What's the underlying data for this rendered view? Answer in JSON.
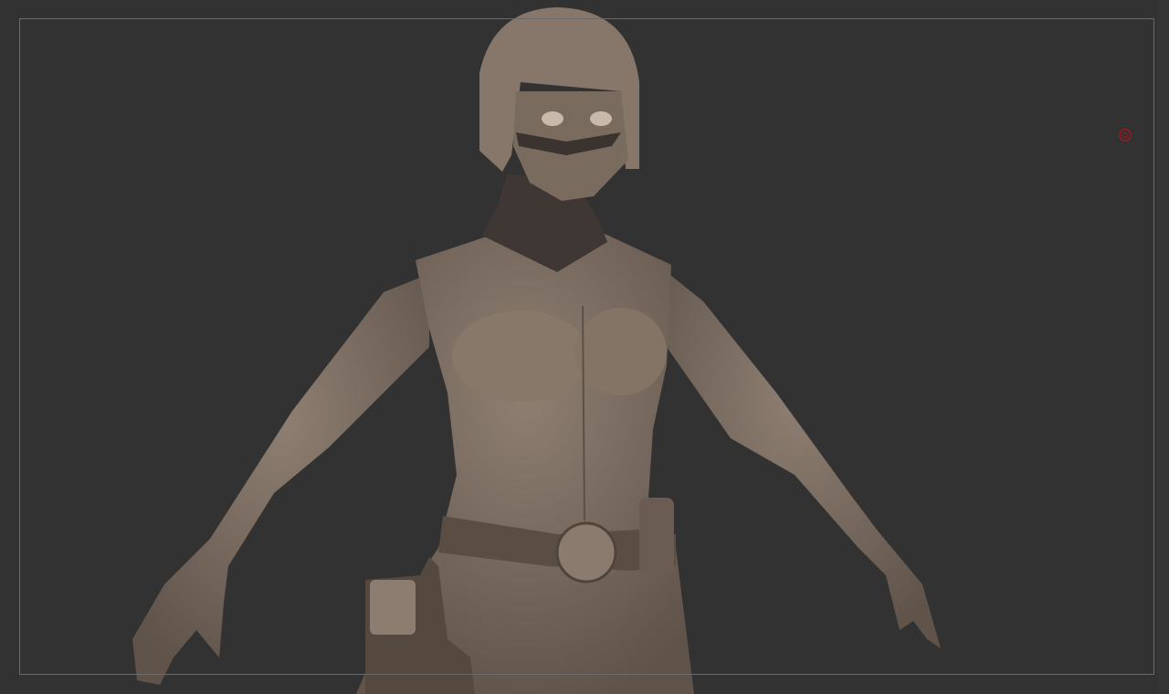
{
  "canvas": {
    "background_color": "#323232",
    "frame_color": "#6a6a6a",
    "model_color": "#7d6e62",
    "dark_material_color": "#3e3733",
    "pivot_color": "#a0161c",
    "pivot_icon": "circle-target-icon"
  }
}
